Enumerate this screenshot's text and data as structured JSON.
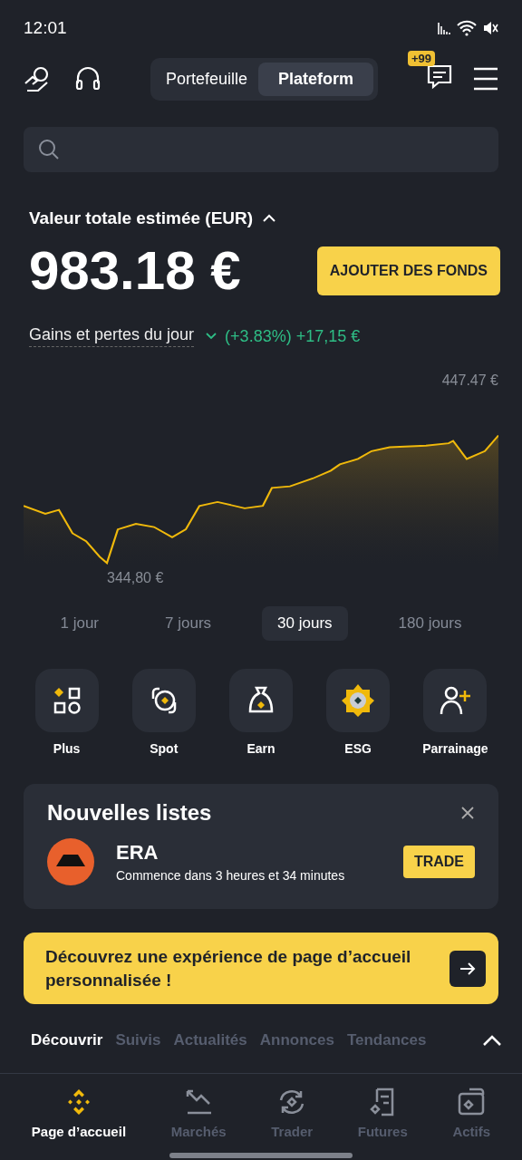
{
  "status_bar": {
    "time": "12:01"
  },
  "header": {
    "segments": [
      {
        "label": "Portefeuille",
        "selected": false
      },
      {
        "label": "Plateform",
        "selected": true
      }
    ],
    "badge": "+99"
  },
  "balance": {
    "title": "Valeur totale estimée (EUR)",
    "expanded": true,
    "value": "983.18 €",
    "button": "AJOUTER DES FONDS",
    "pnl_label": "Gains et pertes du jour",
    "pnl_value": "(+3.83%) +17,15 €",
    "chart_high": "447.47 €",
    "chart_low": "344,80 €"
  },
  "periods": [
    {
      "label": "1 jour",
      "selected": false
    },
    {
      "label": "7 jours",
      "selected": false
    },
    {
      "label": "30 jours",
      "selected": true
    },
    {
      "label": "180 jours",
      "selected": false
    }
  ],
  "shortcuts": [
    {
      "label": "Plus",
      "kind": "plus"
    },
    {
      "label": "Spot",
      "kind": "spot"
    },
    {
      "label": "Earn",
      "kind": "earn"
    },
    {
      "label": "ESG",
      "kind": "esg"
    },
    {
      "label": "Parrainage",
      "kind": "referral"
    }
  ],
  "listing": {
    "title": "Nouvelles listes",
    "token": "ERA",
    "subtitle": "Commence dans 3 heures et 34 minutes",
    "button": "TRADE"
  },
  "banner": {
    "text": "Découvrez une expérience de page d’accueil personnalisée !"
  },
  "feed_tabs": [
    {
      "label": "Découvrir",
      "selected": true
    },
    {
      "label": "Suivis",
      "selected": false
    },
    {
      "label": "Actualités",
      "selected": false
    },
    {
      "label": "Annonces",
      "selected": false
    },
    {
      "label": "Tendances",
      "selected": false
    }
  ],
  "nav": [
    {
      "label": "Page d’accueil",
      "kind": "home",
      "selected": true
    },
    {
      "label": "Marchés",
      "kind": "markets",
      "selected": false
    },
    {
      "label": "Trader",
      "kind": "trade",
      "selected": false
    },
    {
      "label": "Futures",
      "kind": "futures",
      "selected": false
    },
    {
      "label": "Actifs",
      "kind": "assets",
      "selected": false
    }
  ]
}
